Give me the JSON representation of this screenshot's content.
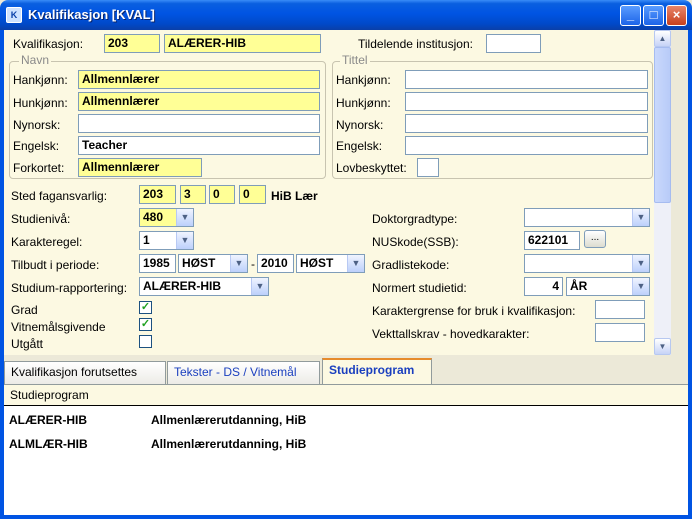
{
  "window": {
    "title": "Kvalifikasjon [KVAL]"
  },
  "form": {
    "kvalifikasjon": {
      "label": "Kvalifikasjon:",
      "code": "203",
      "value": "ALÆRER-HIB"
    },
    "tildelende": {
      "label": "Tildelende institusjon:",
      "value": ""
    },
    "navn": {
      "title": "Navn",
      "hankjonn": {
        "label": "Hankjønn:",
        "value": "Allmennlærer"
      },
      "hunkjonn": {
        "label": "Hunkjønn:",
        "value": "Allmennlærer"
      },
      "nynorsk": {
        "label": "Nynorsk:",
        "value": ""
      },
      "engelsk": {
        "label": "Engelsk:",
        "value": "Teacher"
      },
      "forkortet": {
        "label": "Forkortet:",
        "value": "Allmennlærer"
      }
    },
    "tittel": {
      "title": "Tittel",
      "hankjonn": {
        "label": "Hankjønn:",
        "value": ""
      },
      "hunkjonn": {
        "label": "Hunkjønn:",
        "value": ""
      },
      "nynorsk": {
        "label": "Nynorsk:",
        "value": ""
      },
      "engelsk": {
        "label": "Engelsk:",
        "value": ""
      },
      "lovbeskyttet": {
        "label": "Lovbeskyttet:",
        "value": ""
      }
    },
    "sted": {
      "label": "Sted fagansvarlig:",
      "v1": "203",
      "v2": "3",
      "v3": "0",
      "v4": "0",
      "name": "HiB Lær"
    },
    "studieniva": {
      "label": "Studienivå:",
      "value": "480"
    },
    "karakteregel": {
      "label": "Karakteregel:",
      "value": "1"
    },
    "tilbudt": {
      "label": "Tilbudt i periode:",
      "from_year": "1985",
      "from_term": "HØST",
      "sep": "-",
      "to_year": "2010",
      "to_term": "HØST"
    },
    "studium_rapportering": {
      "label": "Studium-rapportering:",
      "value": "ALÆRER-HIB"
    },
    "grad": {
      "label": "Grad",
      "checked": true
    },
    "vitnemal": {
      "label": "Vitnemålsgivende",
      "checked": true
    },
    "utgatt": {
      "label": "Utgått",
      "checked": false
    },
    "doktorgradtype": {
      "label": "Doktorgradtype:",
      "value": ""
    },
    "nuskode": {
      "label": "NUSkode(SSB):",
      "value": "622101",
      "button": "..."
    },
    "gradlistekode": {
      "label": "Gradlistekode:",
      "value": ""
    },
    "normert": {
      "label": "Normert studietid:",
      "value": "4",
      "unit": "ÅR"
    },
    "karaktergrense": {
      "label": "Karaktergrense for bruk i kvalifikasjon:",
      "value": ""
    },
    "vekttallskrav": {
      "label": "Vekttallskrav - hovedkarakter:",
      "value": ""
    }
  },
  "tabs": [
    {
      "label": "Kvalifikasjon forutsettes"
    },
    {
      "label": "Tekster - DS / Vitnemål"
    },
    {
      "label": "Studieprogram"
    }
  ],
  "studieprogram": {
    "header": "Studieprogram",
    "rows": [
      {
        "code": "ALÆRER-HIB",
        "name": "Allmenlærerutdanning, HiB"
      },
      {
        "code": "ALMLÆR-HIB",
        "name": "Allmenlærerutdanning, HiB"
      }
    ]
  },
  "glyphs": {
    "check": "✓",
    "dropdown": "▼",
    "up": "▲",
    "down": "▼",
    "min": "_",
    "max": "□",
    "close": "×"
  }
}
